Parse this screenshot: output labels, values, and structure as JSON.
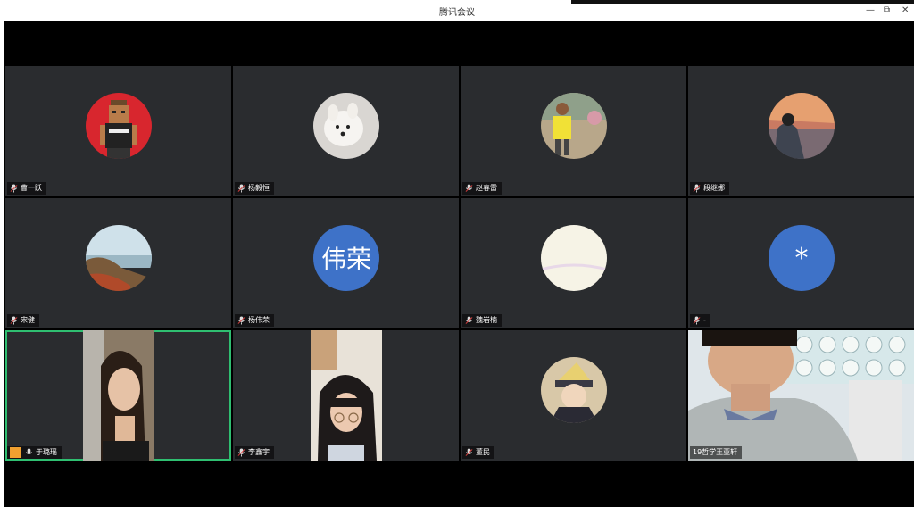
{
  "window": {
    "title": "腾讯会议",
    "controls": {
      "minimize": "—",
      "restore": "⧉",
      "close": "✕"
    }
  },
  "participants": [
    {
      "name": "曹一跃",
      "avatar": "lego-figure"
    },
    {
      "name": "杨毅恒",
      "avatar": "dog-photo"
    },
    {
      "name": "赵春雷",
      "avatar": "person-yellow-shirt-photo"
    },
    {
      "name": "段继娜",
      "avatar": "sunset-photo"
    },
    {
      "name": "宋健",
      "avatar": "landscape-photo"
    },
    {
      "name": "杨伟荣",
      "avatar_text": "伟荣"
    },
    {
      "name": "魏岩楠",
      "avatar": "blank-light-photo"
    },
    {
      "name": "-",
      "avatar_text": "*"
    },
    {
      "name": "于璐瑶",
      "video": true,
      "host": true,
      "speaking": true
    },
    {
      "name": "李鑫宇",
      "video": true
    },
    {
      "name": "董民",
      "avatar": "anime-character"
    },
    {
      "name": "19哲学王亚轩",
      "video": true
    }
  ],
  "colors": {
    "tile_bg": "#2a2c2f",
    "active_border": "#2fbf71",
    "avatar_blue": "#3e72c8"
  }
}
